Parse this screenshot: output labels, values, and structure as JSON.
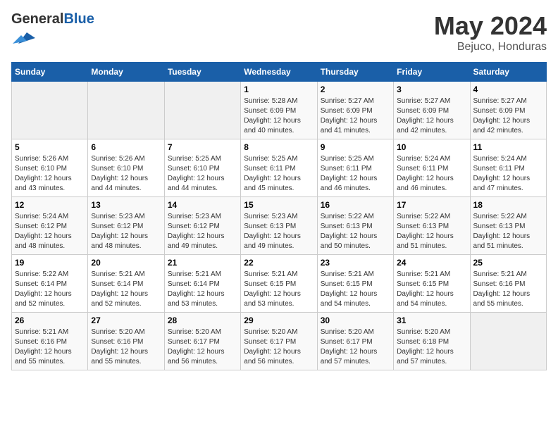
{
  "logo": {
    "general": "General",
    "blue": "Blue"
  },
  "header": {
    "month": "May 2024",
    "location": "Bejuco, Honduras"
  },
  "weekdays": [
    "Sunday",
    "Monday",
    "Tuesday",
    "Wednesday",
    "Thursday",
    "Friday",
    "Saturday"
  ],
  "weeks": [
    [
      {
        "day": "",
        "sunrise": "",
        "sunset": "",
        "daylight": ""
      },
      {
        "day": "",
        "sunrise": "",
        "sunset": "",
        "daylight": ""
      },
      {
        "day": "",
        "sunrise": "",
        "sunset": "",
        "daylight": ""
      },
      {
        "day": "1",
        "sunrise": "Sunrise: 5:28 AM",
        "sunset": "Sunset: 6:09 PM",
        "daylight": "Daylight: 12 hours and 40 minutes."
      },
      {
        "day": "2",
        "sunrise": "Sunrise: 5:27 AM",
        "sunset": "Sunset: 6:09 PM",
        "daylight": "Daylight: 12 hours and 41 minutes."
      },
      {
        "day": "3",
        "sunrise": "Sunrise: 5:27 AM",
        "sunset": "Sunset: 6:09 PM",
        "daylight": "Daylight: 12 hours and 42 minutes."
      },
      {
        "day": "4",
        "sunrise": "Sunrise: 5:27 AM",
        "sunset": "Sunset: 6:09 PM",
        "daylight": "Daylight: 12 hours and 42 minutes."
      }
    ],
    [
      {
        "day": "5",
        "sunrise": "Sunrise: 5:26 AM",
        "sunset": "Sunset: 6:10 PM",
        "daylight": "Daylight: 12 hours and 43 minutes."
      },
      {
        "day": "6",
        "sunrise": "Sunrise: 5:26 AM",
        "sunset": "Sunset: 6:10 PM",
        "daylight": "Daylight: 12 hours and 44 minutes."
      },
      {
        "day": "7",
        "sunrise": "Sunrise: 5:25 AM",
        "sunset": "Sunset: 6:10 PM",
        "daylight": "Daylight: 12 hours and 44 minutes."
      },
      {
        "day": "8",
        "sunrise": "Sunrise: 5:25 AM",
        "sunset": "Sunset: 6:11 PM",
        "daylight": "Daylight: 12 hours and 45 minutes."
      },
      {
        "day": "9",
        "sunrise": "Sunrise: 5:25 AM",
        "sunset": "Sunset: 6:11 PM",
        "daylight": "Daylight: 12 hours and 46 minutes."
      },
      {
        "day": "10",
        "sunrise": "Sunrise: 5:24 AM",
        "sunset": "Sunset: 6:11 PM",
        "daylight": "Daylight: 12 hours and 46 minutes."
      },
      {
        "day": "11",
        "sunrise": "Sunrise: 5:24 AM",
        "sunset": "Sunset: 6:11 PM",
        "daylight": "Daylight: 12 hours and 47 minutes."
      }
    ],
    [
      {
        "day": "12",
        "sunrise": "Sunrise: 5:24 AM",
        "sunset": "Sunset: 6:12 PM",
        "daylight": "Daylight: 12 hours and 48 minutes."
      },
      {
        "day": "13",
        "sunrise": "Sunrise: 5:23 AM",
        "sunset": "Sunset: 6:12 PM",
        "daylight": "Daylight: 12 hours and 48 minutes."
      },
      {
        "day": "14",
        "sunrise": "Sunrise: 5:23 AM",
        "sunset": "Sunset: 6:12 PM",
        "daylight": "Daylight: 12 hours and 49 minutes."
      },
      {
        "day": "15",
        "sunrise": "Sunrise: 5:23 AM",
        "sunset": "Sunset: 6:13 PM",
        "daylight": "Daylight: 12 hours and 49 minutes."
      },
      {
        "day": "16",
        "sunrise": "Sunrise: 5:22 AM",
        "sunset": "Sunset: 6:13 PM",
        "daylight": "Daylight: 12 hours and 50 minutes."
      },
      {
        "day": "17",
        "sunrise": "Sunrise: 5:22 AM",
        "sunset": "Sunset: 6:13 PM",
        "daylight": "Daylight: 12 hours and 51 minutes."
      },
      {
        "day": "18",
        "sunrise": "Sunrise: 5:22 AM",
        "sunset": "Sunset: 6:13 PM",
        "daylight": "Daylight: 12 hours and 51 minutes."
      }
    ],
    [
      {
        "day": "19",
        "sunrise": "Sunrise: 5:22 AM",
        "sunset": "Sunset: 6:14 PM",
        "daylight": "Daylight: 12 hours and 52 minutes."
      },
      {
        "day": "20",
        "sunrise": "Sunrise: 5:21 AM",
        "sunset": "Sunset: 6:14 PM",
        "daylight": "Daylight: 12 hours and 52 minutes."
      },
      {
        "day": "21",
        "sunrise": "Sunrise: 5:21 AM",
        "sunset": "Sunset: 6:14 PM",
        "daylight": "Daylight: 12 hours and 53 minutes."
      },
      {
        "day": "22",
        "sunrise": "Sunrise: 5:21 AM",
        "sunset": "Sunset: 6:15 PM",
        "daylight": "Daylight: 12 hours and 53 minutes."
      },
      {
        "day": "23",
        "sunrise": "Sunrise: 5:21 AM",
        "sunset": "Sunset: 6:15 PM",
        "daylight": "Daylight: 12 hours and 54 minutes."
      },
      {
        "day": "24",
        "sunrise": "Sunrise: 5:21 AM",
        "sunset": "Sunset: 6:15 PM",
        "daylight": "Daylight: 12 hours and 54 minutes."
      },
      {
        "day": "25",
        "sunrise": "Sunrise: 5:21 AM",
        "sunset": "Sunset: 6:16 PM",
        "daylight": "Daylight: 12 hours and 55 minutes."
      }
    ],
    [
      {
        "day": "26",
        "sunrise": "Sunrise: 5:21 AM",
        "sunset": "Sunset: 6:16 PM",
        "daylight": "Daylight: 12 hours and 55 minutes."
      },
      {
        "day": "27",
        "sunrise": "Sunrise: 5:20 AM",
        "sunset": "Sunset: 6:16 PM",
        "daylight": "Daylight: 12 hours and 55 minutes."
      },
      {
        "day": "28",
        "sunrise": "Sunrise: 5:20 AM",
        "sunset": "Sunset: 6:17 PM",
        "daylight": "Daylight: 12 hours and 56 minutes."
      },
      {
        "day": "29",
        "sunrise": "Sunrise: 5:20 AM",
        "sunset": "Sunset: 6:17 PM",
        "daylight": "Daylight: 12 hours and 56 minutes."
      },
      {
        "day": "30",
        "sunrise": "Sunrise: 5:20 AM",
        "sunset": "Sunset: 6:17 PM",
        "daylight": "Daylight: 12 hours and 57 minutes."
      },
      {
        "day": "31",
        "sunrise": "Sunrise: 5:20 AM",
        "sunset": "Sunset: 6:18 PM",
        "daylight": "Daylight: 12 hours and 57 minutes."
      },
      {
        "day": "",
        "sunrise": "",
        "sunset": "",
        "daylight": ""
      }
    ]
  ]
}
